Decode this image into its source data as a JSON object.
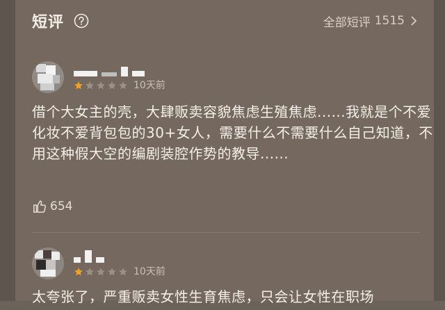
{
  "header": {
    "title": "短评",
    "all_reviews_label": "全部短评",
    "all_reviews_count": "1515"
  },
  "reviews": [
    {
      "rating": 1,
      "date": "10天前",
      "content": "借个大女主的壳，大肆贩卖容貌焦虑生殖焦虑......我就是个不爱化妆不爱背包包的30+女人，需要什么不需要什么自己知道，不用这种假大空的编剧装腔作势的教导......",
      "likes": "654"
    },
    {
      "rating": 1,
      "date": "10天前",
      "content": "太夸张了，严重贩卖女性生育焦虑，只会让女性在职场"
    }
  ],
  "colors": {
    "star_active": "#f4a123",
    "star_inactive": "#9b9088"
  },
  "icons": {
    "help": "question-circle-icon",
    "chevron": "chevron-right-icon",
    "like": "thumbs-up-icon"
  }
}
